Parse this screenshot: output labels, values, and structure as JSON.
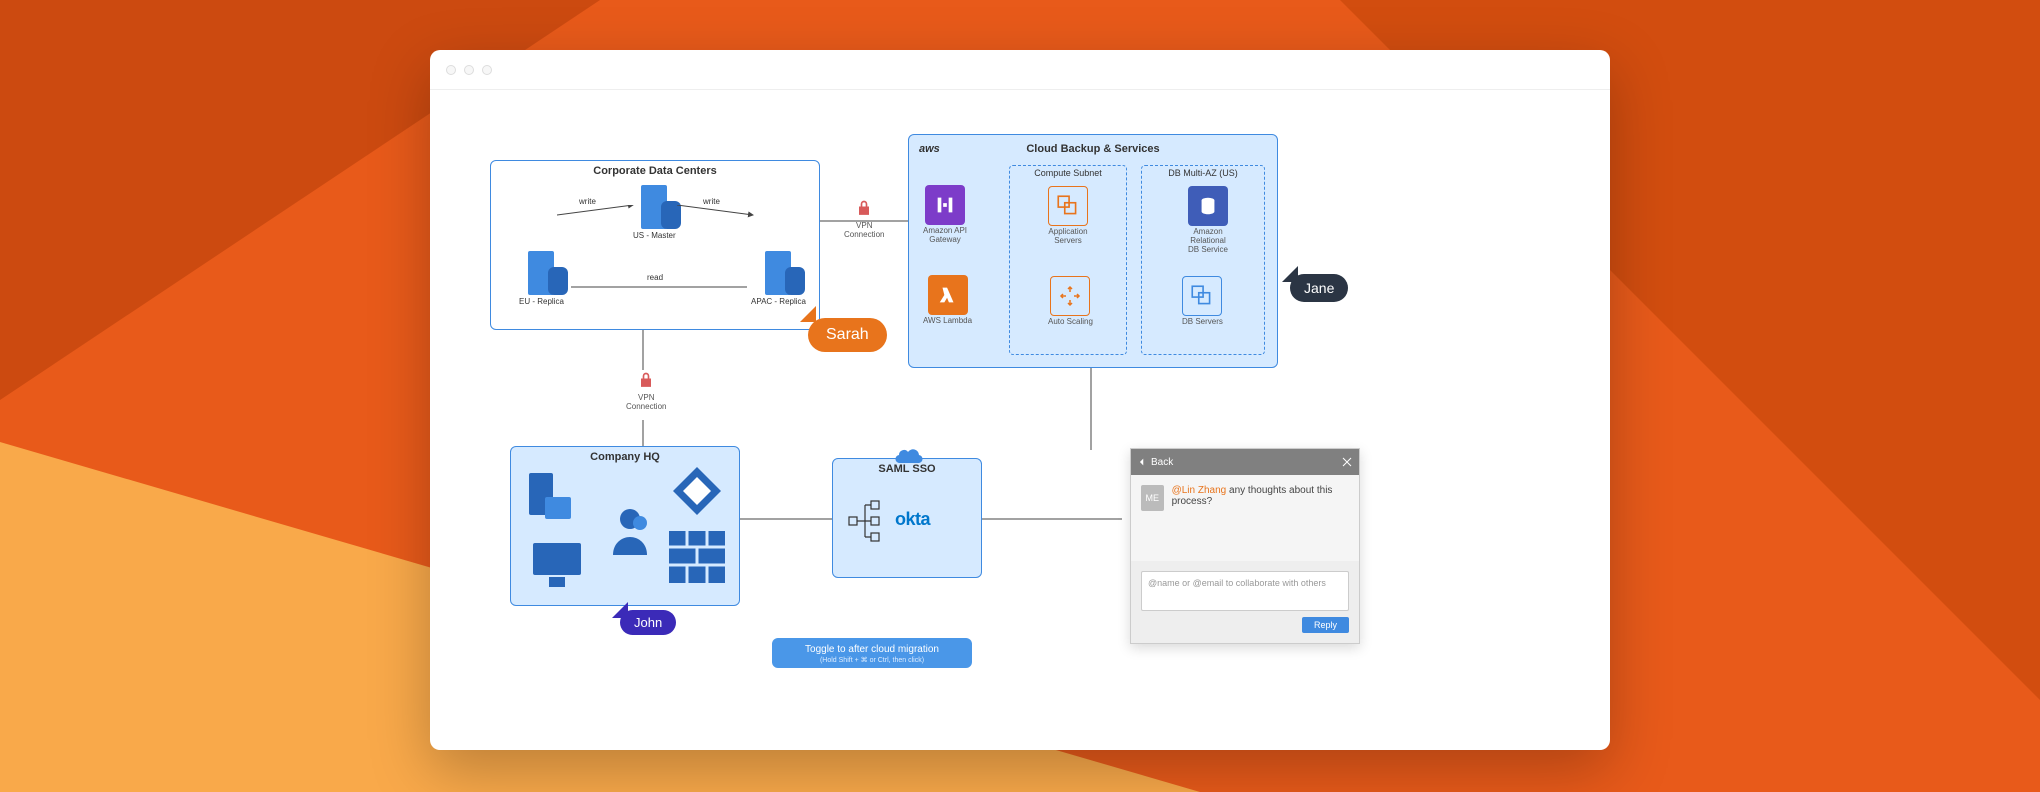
{
  "background": {
    "primary": "#e85a1a",
    "dark": "#cc4a10",
    "light": "#f9a94a"
  },
  "corporate": {
    "title": "Corporate Data Centers",
    "us_master": "US - Master",
    "eu_replica": "EU - Replica",
    "apac_replica": "APAC - Replica",
    "write_label": "write",
    "read_label": "read"
  },
  "vpn": {
    "label": "VPN\nConnection"
  },
  "aws": {
    "logo": "aws",
    "title": "Cloud Backup & Services",
    "compute_group": "Compute Subnet",
    "db_group": "DB Multi-AZ (US)",
    "api_gateway": "Amazon API\nGateway",
    "lambda": "AWS Lambda",
    "app_servers": "Application\nServers",
    "auto_scaling": "Auto Scaling",
    "rds": "Amazon Relational\nDB Service",
    "db_servers": "DB Servers"
  },
  "hq": {
    "title": "Company HQ"
  },
  "sso": {
    "title": "SAML SSO",
    "provider": "okta"
  },
  "toggle": {
    "main": "Toggle to after cloud migration",
    "sub": "(Hold Shift + ⌘ or Ctrl, then click)"
  },
  "cursors": {
    "sarah": "Sarah",
    "jane": "Jane",
    "john": "John"
  },
  "comments": {
    "back": "Back",
    "avatar": "ME",
    "mention": "@Lin Zhang",
    "body": " any thoughts about this process?",
    "placeholder": "@name or @email to collaborate with others",
    "reply": "Reply"
  }
}
